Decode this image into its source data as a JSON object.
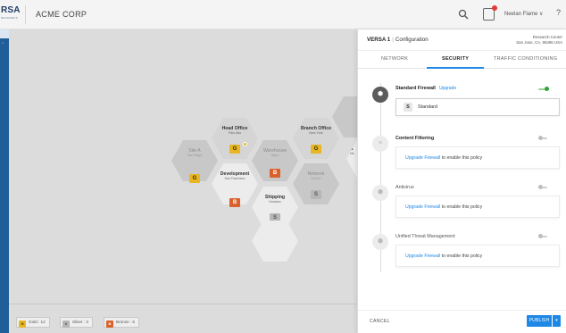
{
  "app": {
    "logo_text": "RSA",
    "logo_subtext": "NETWORKS",
    "company": "ACME CORP",
    "user": "Neelan Flame",
    "help": "?"
  },
  "icons": {
    "search": "search-icon",
    "alert": "alert-icon",
    "user_menu": "chevron-down-icon",
    "help": "help-icon"
  },
  "canvas": {
    "nodes": [
      {
        "name": "Head Office",
        "loc": "Palo Alto",
        "badge": "G",
        "badge_type": "gold",
        "starred": true
      },
      {
        "name": "Branch Office",
        "loc": "New York",
        "badge": "G",
        "badge_type": "gold",
        "starred": false
      },
      {
        "name": "Site A",
        "loc": "San Diego",
        "badge": "",
        "badge_type": "",
        "starred": false
      },
      {
        "name": "Warehouse",
        "loc": "Napa",
        "badge": "B",
        "badge_type": "orange",
        "starred": false
      },
      {
        "name": "",
        "loc": "",
        "badge": "G",
        "badge_type": "gold",
        "starred": false
      },
      {
        "name": "Development",
        "loc": "San Francisco",
        "badge": "",
        "badge_type": "",
        "starred": false
      },
      {
        "name": "Network",
        "loc": "Denver",
        "badge": "S",
        "badge_type": "plain",
        "starred": false
      },
      {
        "name": "",
        "loc": "",
        "badge": "B",
        "badge_type": "orange",
        "starred": false
      },
      {
        "name": "Shipping",
        "loc": "Houston",
        "badge": "S",
        "badge_type": "plain",
        "starred": false
      },
      {
        "name": "S",
        "loc": "Ne",
        "badge": "",
        "badge_type": "",
        "starred": false
      }
    ],
    "legend": [
      {
        "code": "G",
        "label": "Gold : 12",
        "color": "#e7b622"
      },
      {
        "code": "S",
        "label": "Silver : 3",
        "color": "#b6b6b6"
      },
      {
        "code": "B",
        "label": "Bronze : 6",
        "color": "#d9622b"
      }
    ]
  },
  "panel": {
    "device": "VERSA 1",
    "section": "Configuration",
    "site_name": "Research Center",
    "site_address": "San Jose, CA, 95496 USA",
    "tabs": [
      "NETWORK",
      "SECURITY",
      "TRAFFIC CONDITIONING"
    ],
    "active_tab": "SECURITY",
    "policies": [
      {
        "title": "Standard Firewall",
        "link": "Upgrade",
        "enabled": true,
        "value_badge": "S",
        "value_text": "Standard"
      },
      {
        "title": "Content Filtering",
        "link_text": "Upgrade Firewall",
        "tail_text": "to enable this policy",
        "enabled": false
      },
      {
        "title": "Antivirus",
        "link_text": "Upgrade Firewall",
        "tail_text": "to enable this policy",
        "enabled": false
      },
      {
        "title": "Unified Threat Management",
        "link_text": "Upgrade Firewall",
        "tail_text": "to enable this policy",
        "enabled": false
      }
    ],
    "cancel_label": "CANCEL",
    "publish_label": "PUBLISH",
    "publish_menu": "▾"
  },
  "colors": {
    "accent": "#1e88e5",
    "rail": "#1f5e98",
    "toggle_on": "#2fa33a",
    "gold": "#e7b622",
    "bronze": "#d9622b",
    "silver": "#b6b6b6"
  }
}
